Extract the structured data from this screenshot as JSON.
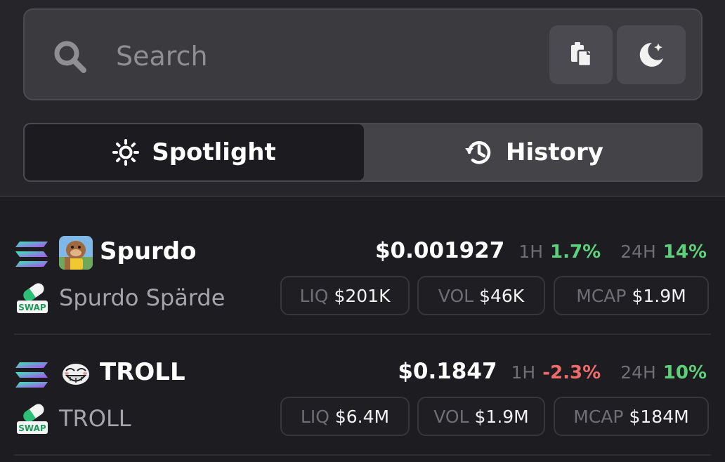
{
  "search": {
    "placeholder": "Search"
  },
  "tabs": [
    {
      "label": "Spotlight",
      "icon": "sun-icon",
      "active": true
    },
    {
      "label": "History",
      "icon": "history-icon",
      "active": false
    }
  ],
  "tokens": [
    {
      "symbol": "Spurdo",
      "name": "Spurdo Spärde",
      "price": "$0.001927",
      "h1_label": "1H",
      "h1_change": "1.7%",
      "h24_label": "24H",
      "h24_change": "14%",
      "liq_label": "LIQ",
      "liq": "$201K",
      "vol_label": "VOL",
      "vol": "$46K",
      "mcap_label": "MCAP",
      "mcap": "$1.9M",
      "chain_icon": "solana-icon",
      "dex_icon": "swap-icon",
      "swap_text": "SWAP"
    },
    {
      "symbol": "TROLL",
      "name": "TROLL",
      "price": "$0.1847",
      "h1_label": "1H",
      "h1_change": "-2.3%",
      "h24_label": "24H",
      "h24_change": "10%",
      "liq_label": "LIQ",
      "liq": "$6.4M",
      "vol_label": "VOL",
      "vol": "$1.9M",
      "mcap_label": "MCAP",
      "mcap": "$184M",
      "chain_icon": "solana-icon",
      "dex_icon": "swap-icon",
      "swap_text": "SWAP"
    }
  ],
  "colors": {
    "positive": "#5dd07a",
    "negative": "#ee6b6b",
    "background": "#1d1d21",
    "panel": "#26262a"
  }
}
